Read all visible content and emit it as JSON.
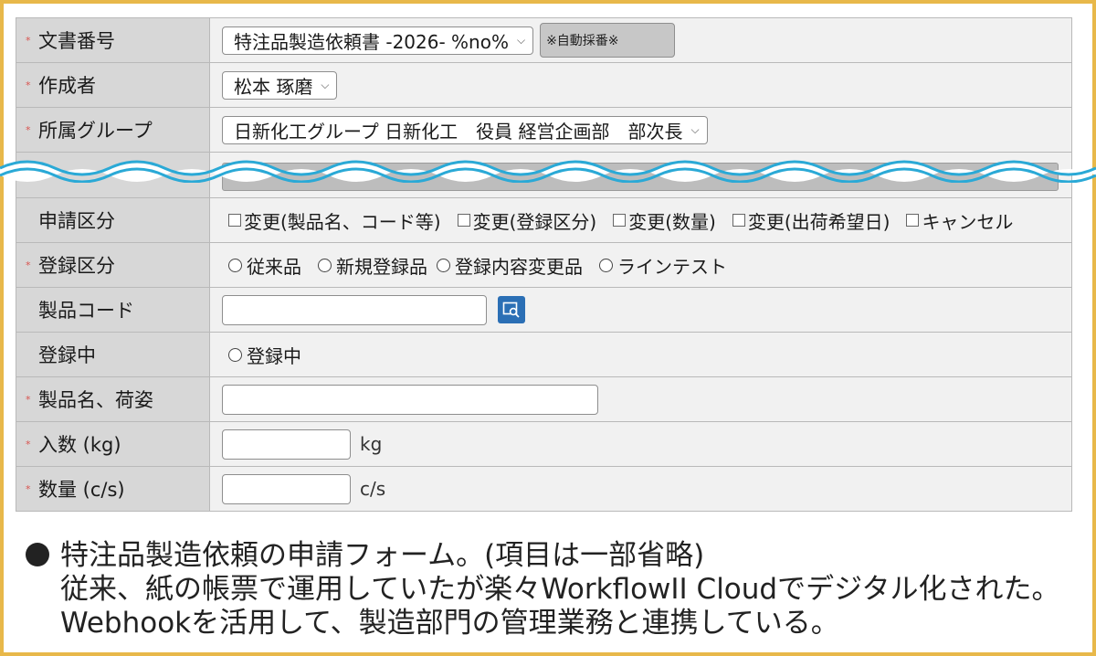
{
  "form": {
    "doc_number": {
      "label": "文書番号",
      "value": "特注品製造依頼書 -2026- %no%",
      "badge": "※自動採番※"
    },
    "author": {
      "label": "作成者",
      "value": "松本 琢磨"
    },
    "group": {
      "label": "所属グループ",
      "value": "日新化工グループ 日新化工　役員 経営企画部　部次長"
    },
    "application_type": {
      "label": "申請区分",
      "options": [
        "変更(製品名、コード等)",
        "変更(登録区分)",
        "変更(数量)",
        "変更(出荷希望日)",
        "キャンセル"
      ]
    },
    "registration_type": {
      "label": "登録区分",
      "options": [
        "従来品",
        "新規登録品",
        "登録内容変更品",
        "ラインテスト"
      ]
    },
    "product_code": {
      "label": "製品コード",
      "value": ""
    },
    "registering": {
      "label": "登録中",
      "option": "登録中"
    },
    "product_name": {
      "label": "製品名、荷姿",
      "value": ""
    },
    "quantity_kg": {
      "label": "入数 (kg)",
      "value": "",
      "unit": "kg"
    },
    "quantity_cs": {
      "label": "数量 (c/s)",
      "value": "",
      "unit": "c/s"
    }
  },
  "caption": {
    "line1": "特注品製造依頼の申請フォーム。(項目は一部省略)",
    "line2": "従来、紙の帳票で運用していたが楽々WorkflowII Cloudでデジタル化された。",
    "line3": "Webhookを活用して、製造部門の管理業務と連携している。"
  },
  "colors": {
    "border": "#e8b84a",
    "label_bg": "#d7d7d7",
    "field_bg": "#f1f1f1",
    "required_mark": "#d9534f",
    "search_button": "#2b6fb5",
    "wave": "#2aa9d6"
  },
  "icons": {
    "search": "search-icon",
    "dropdown": "chevron-down-icon",
    "required": "required-asterisk"
  }
}
